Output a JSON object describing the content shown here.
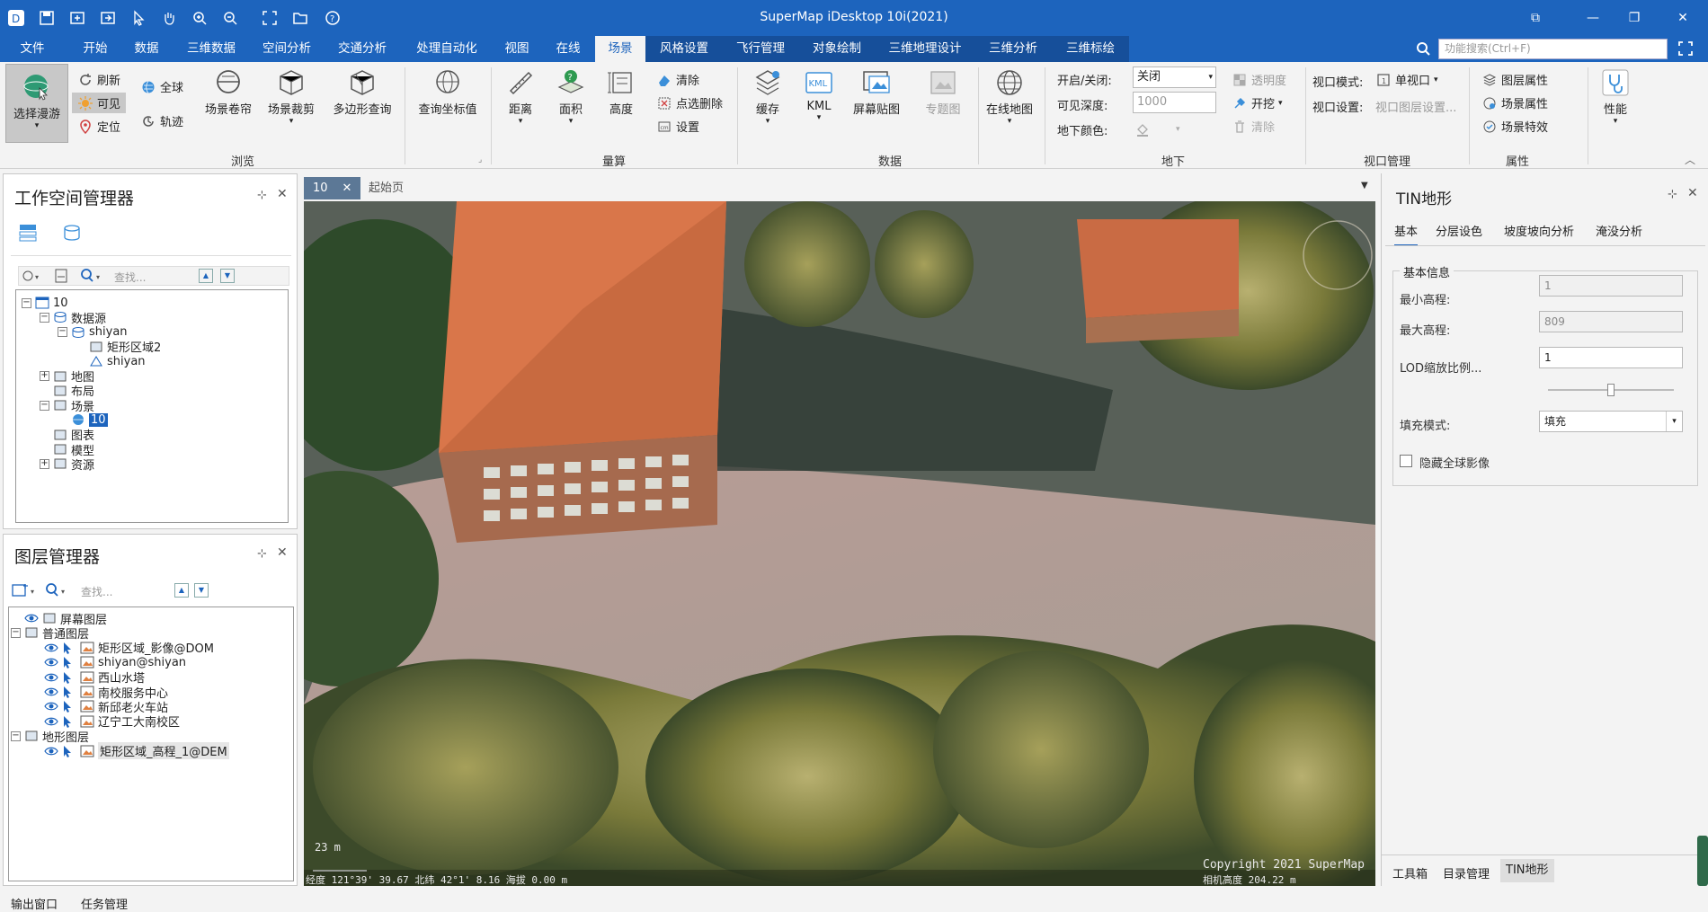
{
  "app": {
    "title": "SuperMap iDesktop 10i(2021)"
  },
  "menu": {
    "tabs": [
      "文件",
      "开始",
      "数据",
      "三维数据",
      "空间分析",
      "交通分析",
      "处理自动化",
      "视图",
      "在线",
      "场景",
      "风格设置",
      "飞行管理",
      "对象绘制",
      "三维地理设计",
      "三维分析",
      "三维标绘"
    ],
    "active": "场景",
    "search_placeholder": "功能搜索(Ctrl+F)"
  },
  "ribbon": {
    "browse": {
      "roam": "选择漫游",
      "refresh": "刷新",
      "visible": "可见",
      "locate": "定位",
      "globe": "全球",
      "track": "轨迹",
      "scroll": "场景卷帘",
      "clip": "场景裁剪",
      "poly_query": "多边形查询",
      "query_coord": "查询坐标值",
      "group": "浏览"
    },
    "measure": {
      "distance": "距离",
      "area": "面积",
      "height": "高度",
      "clear": "清除",
      "point_delete": "点选删除",
      "settings": "设置",
      "group": "量算"
    },
    "data": {
      "cache": "缓存",
      "kml": "KML",
      "screen_map": "屏幕贴图",
      "thematic": "专题图",
      "online_map": "在线地图",
      "group": "数据"
    },
    "underground": {
      "toggle_label": "开启/关闭:",
      "toggle_value": "关闭",
      "depth_label": "可见深度:",
      "depth_value": "1000",
      "color_label": "地下颜色:",
      "transparency": "透明度",
      "excavate": "开挖",
      "clear": "清除",
      "group": "地下"
    },
    "viewport": {
      "mode_label": "视口模式:",
      "mode_value": "单视口",
      "settings_label": "视口设置:",
      "settings_value": "视口图层设置...",
      "group": "视口管理"
    },
    "props": {
      "layer": "图层属性",
      "scene": "场景属性",
      "effects": "场景特效",
      "group": "属性"
    },
    "perf": {
      "label": "性能"
    }
  },
  "workspace": {
    "title": "工作空间管理器",
    "search_placeholder": "查找...",
    "items": [
      {
        "label": "10",
        "level": 0,
        "expander": "−"
      },
      {
        "label": "数据源",
        "level": 1,
        "expander": "−"
      },
      {
        "label": "shiyan",
        "level": 2,
        "expander": "−"
      },
      {
        "label": "矩形区域2",
        "level": 3,
        "expander": ""
      },
      {
        "label": "shiyan",
        "level": 3,
        "expander": ""
      },
      {
        "label": "地图",
        "level": 1,
        "expander": "+"
      },
      {
        "label": "布局",
        "level": 1,
        "expander": ""
      },
      {
        "label": "场景",
        "level": 1,
        "expander": "−"
      },
      {
        "label": "10",
        "level": 2,
        "expander": "",
        "selected": true
      },
      {
        "label": "图表",
        "level": 1,
        "expander": ""
      },
      {
        "label": "模型",
        "level": 1,
        "expander": ""
      },
      {
        "label": "资源",
        "level": 1,
        "expander": "+"
      }
    ]
  },
  "layers": {
    "title": "图层管理器",
    "search_placeholder": "查找...",
    "items": [
      {
        "label": "屏幕图层",
        "level": 0,
        "expander": "",
        "eye": true
      },
      {
        "label": "普通图层",
        "level": 0,
        "expander": "−",
        "eye": false
      },
      {
        "label": "矩形区域_影像@DOM",
        "level": 1,
        "expander": "",
        "eye": true
      },
      {
        "label": "shiyan@shiyan",
        "level": 1,
        "expander": "",
        "eye": true
      },
      {
        "label": "西山水塔",
        "level": 1,
        "expander": "",
        "eye": true
      },
      {
        "label": "南校服务中心",
        "level": 1,
        "expander": "",
        "eye": true
      },
      {
        "label": "新邱老火车站",
        "level": 1,
        "expander": "",
        "eye": true
      },
      {
        "label": "辽宁工大南校区",
        "level": 1,
        "expander": "",
        "eye": true
      },
      {
        "label": "地形图层",
        "level": 0,
        "expander": "−",
        "eye": false
      },
      {
        "label": "矩形区域_高程_1@DEM",
        "level": 1,
        "expander": "",
        "eye": true,
        "selected": true
      }
    ]
  },
  "doctabs": {
    "active": "10",
    "start": "起始页"
  },
  "scene": {
    "scale": "23 m",
    "copyright": "Copyright 2021 SuperMap",
    "status_left": "经度 121°39'  39.67  北纬 42°1'   8.16    海拔 0.00 m",
    "status_right": "相机高度 204.22 m"
  },
  "tin": {
    "title": "TIN地形",
    "tabs": [
      "基本",
      "分层设色",
      "坡度坡向分析",
      "淹没分析"
    ],
    "group": "基本信息",
    "min_label": "最小高程:",
    "min_value": "1",
    "max_label": "最大高程:",
    "max_value": "809",
    "lod_label": "LOD缩放比例...",
    "lod_value": "1",
    "slider": 0.5,
    "fill_label": "填充模式:",
    "fill_value": "填充",
    "hide_label": "隐藏全球影像",
    "bottom_tabs": [
      "工具箱",
      "目录管理",
      "TIN地形"
    ]
  },
  "statusbar": {
    "output": "输出窗口",
    "tasks": "任务管理"
  },
  "colors": {
    "accent": "#1d64bd",
    "roof": "#d9764a"
  }
}
